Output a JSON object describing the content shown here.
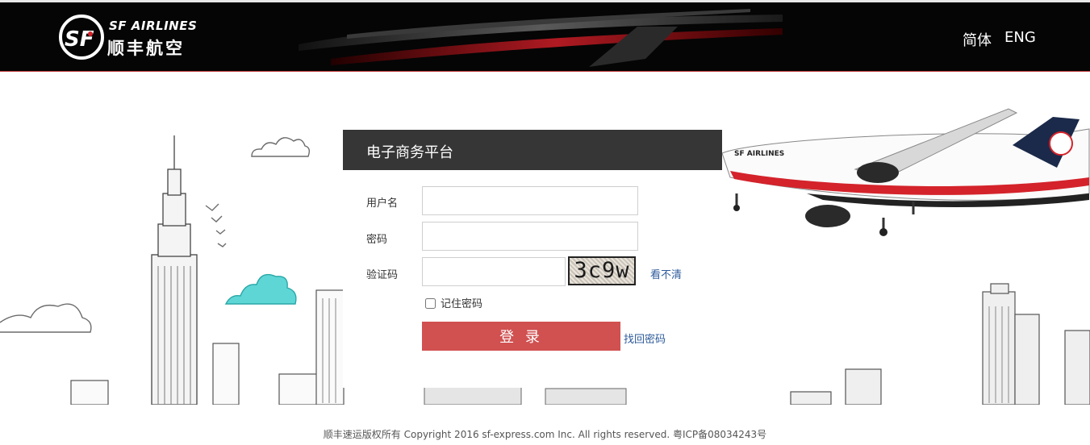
{
  "header": {
    "logo_en": "SF AIRLINES",
    "logo_cn": "顺丰航空",
    "lang_cn": "简体",
    "lang_en": "ENG"
  },
  "login": {
    "title": "电子商务平台",
    "username_label": "用户名",
    "username_value": "",
    "password_label": "密码",
    "password_value": "",
    "captcha_label": "验证码",
    "captcha_value": "",
    "captcha_image_text": "3c9w",
    "refresh_captcha": "看不清",
    "remember_label": "记住密码",
    "remember_checked": false,
    "submit_label": "登 录",
    "forgot_password": "找回密码"
  },
  "footer": {
    "copyright": "顺丰速运版权所有 Copyright 2016 sf-express.com Inc. All rights reserved. 粤ICP备08034243号"
  },
  "colors": {
    "header_bg": "#050505",
    "panel_header_bg": "#363636",
    "button_bg": "#d15050",
    "link": "#2d5b9b",
    "brand_red": "#d4232b"
  },
  "icons": [
    "sf-logo-icon",
    "airplane-illustration",
    "city-sketch-illustration",
    "cloud-icon"
  ]
}
